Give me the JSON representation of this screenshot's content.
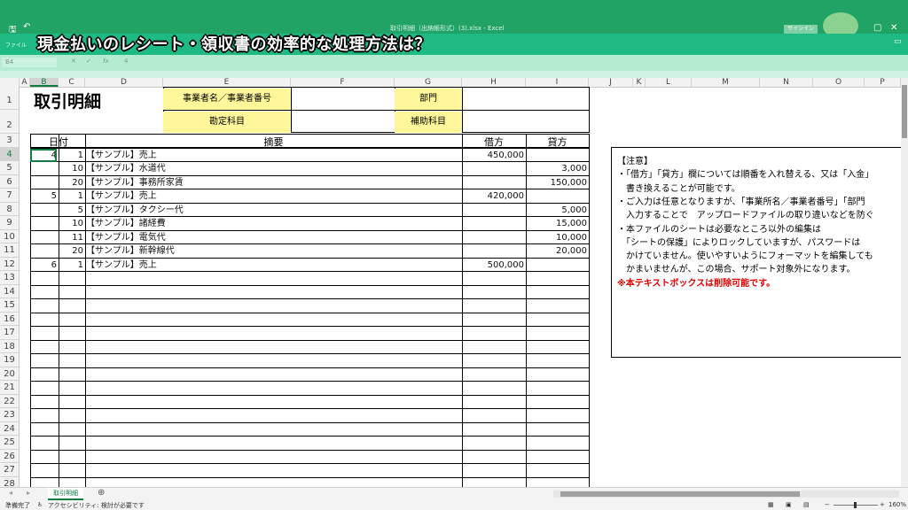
{
  "window": {
    "title": "取引明細（出納帳形式）(3).xlsx  -  Excel",
    "menu_file": "ファイル",
    "sign_in": "サインイン"
  },
  "caption": "現金払いのレシート・領収書の効率的な処理方法は？",
  "formula_bar": {
    "name_box": "B4",
    "cancel": "✕",
    "confirm": "✓",
    "fx": "fx",
    "value": "4"
  },
  "columns": [
    "A",
    "B",
    "C",
    "D",
    "E",
    "F",
    "G",
    "H",
    "I",
    "J",
    "K",
    "L",
    "M",
    "N",
    "O",
    "P"
  ],
  "rows": [
    "1",
    "2",
    "3",
    "4",
    "5",
    "6",
    "7",
    "8",
    "9",
    "10",
    "11",
    "12",
    "13",
    "14",
    "15",
    "16",
    "17",
    "18",
    "19",
    "20",
    "21",
    "22",
    "23",
    "24",
    "25",
    "26",
    "27",
    "28"
  ],
  "sheet": {
    "title": "取引明細",
    "business_label": "事業者名／事業者番号",
    "account_label": "勘定科目",
    "department_label": "部門",
    "sub_account_label": "補助科目",
    "col_date": "日付",
    "col_summary": "摘要",
    "col_debit": "借方",
    "col_credit": "貸方",
    "entries": [
      {
        "month": "4",
        "day": "1",
        "desc": "【サンプル】売上",
        "debit": "450,000",
        "credit": ""
      },
      {
        "month": "",
        "day": "10",
        "desc": "【サンプル】水道代",
        "debit": "",
        "credit": "3,000"
      },
      {
        "month": "",
        "day": "20",
        "desc": "【サンプル】事務所家賃",
        "debit": "",
        "credit": "150,000"
      },
      {
        "month": "5",
        "day": "1",
        "desc": "【サンプル】売上",
        "debit": "420,000",
        "credit": ""
      },
      {
        "month": "",
        "day": "5",
        "desc": "【サンプル】タクシー代",
        "debit": "",
        "credit": "5,000"
      },
      {
        "month": "",
        "day": "10",
        "desc": "【サンプル】諸経費",
        "debit": "",
        "credit": "15,000"
      },
      {
        "month": "",
        "day": "11",
        "desc": "【サンプル】電気代",
        "debit": "",
        "credit": "10,000"
      },
      {
        "month": "",
        "day": "20",
        "desc": "【サンプル】新幹線代",
        "debit": "",
        "credit": "20,000"
      },
      {
        "month": "6",
        "day": "1",
        "desc": "【サンプル】売上",
        "debit": "500,000",
        "credit": ""
      }
    ]
  },
  "note": {
    "lines": [
      "【注意】",
      "・「借方」「貸方」欄については順番を入れ替える、又は「入金」",
      "　書き換えることが可能です。",
      "・ご入力は任意となりますが、「事業所名／事業者番号」「部門",
      "　入力することで　アップロードファイルの取り違いなどを防ぐ",
      "・本ファイルのシートは必要なところ以外の編集は",
      "　「シートの保護」によりロックしていますが、パスワードは",
      "　かけていません。使いやすいようにフォーマットを編集しても",
      "　かまいませんが、この場合、サポート対象外になります。"
    ],
    "red_line": "※本テキストボックスは削除可能です。"
  },
  "sheet_tab": "取引明細",
  "add_sheet": "⊕",
  "status": {
    "ready": "準備完了",
    "accessibility": "アクセシビリティ: 検討が必要です",
    "zoom": "160%"
  }
}
